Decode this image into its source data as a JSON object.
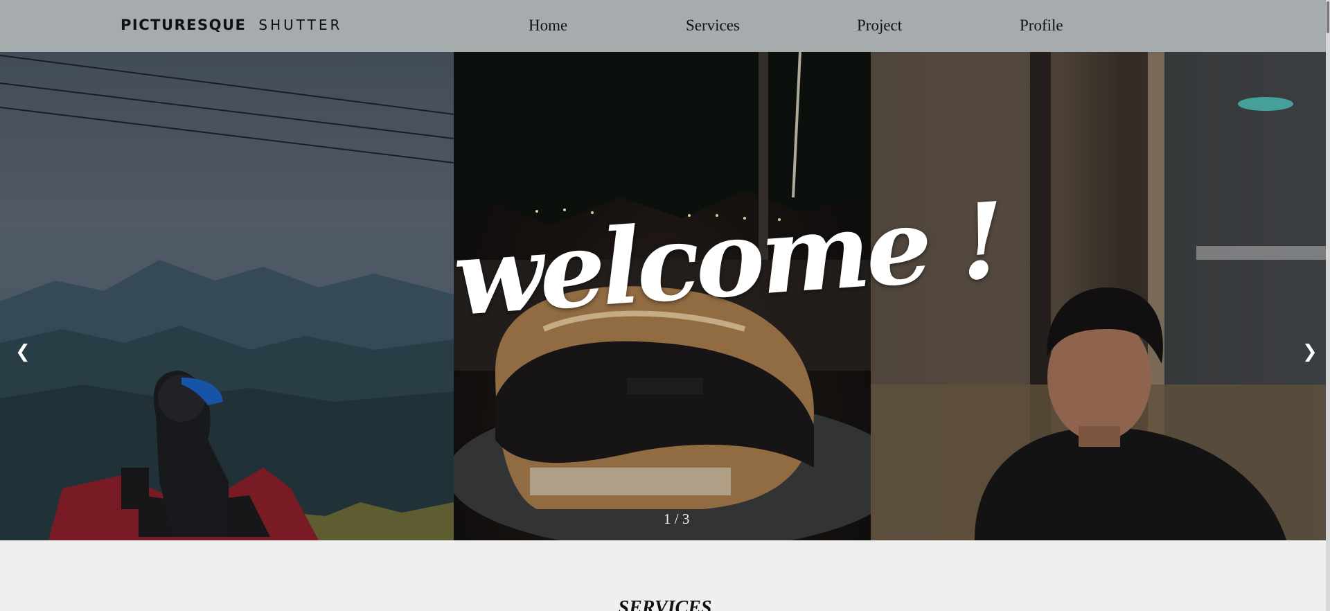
{
  "brand": {
    "main": "PICTURESQUE",
    "sub": "SHUTTER"
  },
  "nav": {
    "home": "Home",
    "services": "Services",
    "project": "Project",
    "profile": "Profile"
  },
  "hero": {
    "welcome_text": "welcome !",
    "prev_arrow": "❮",
    "next_arrow": "❯",
    "counter": "1 / 3",
    "panels": [
      {
        "name": "rider on motorcycle by mountains"
      },
      {
        "name": "motorcycle helmet at night"
      },
      {
        "name": "man in cafe"
      }
    ]
  },
  "services": {
    "heading": "SERVICES"
  }
}
